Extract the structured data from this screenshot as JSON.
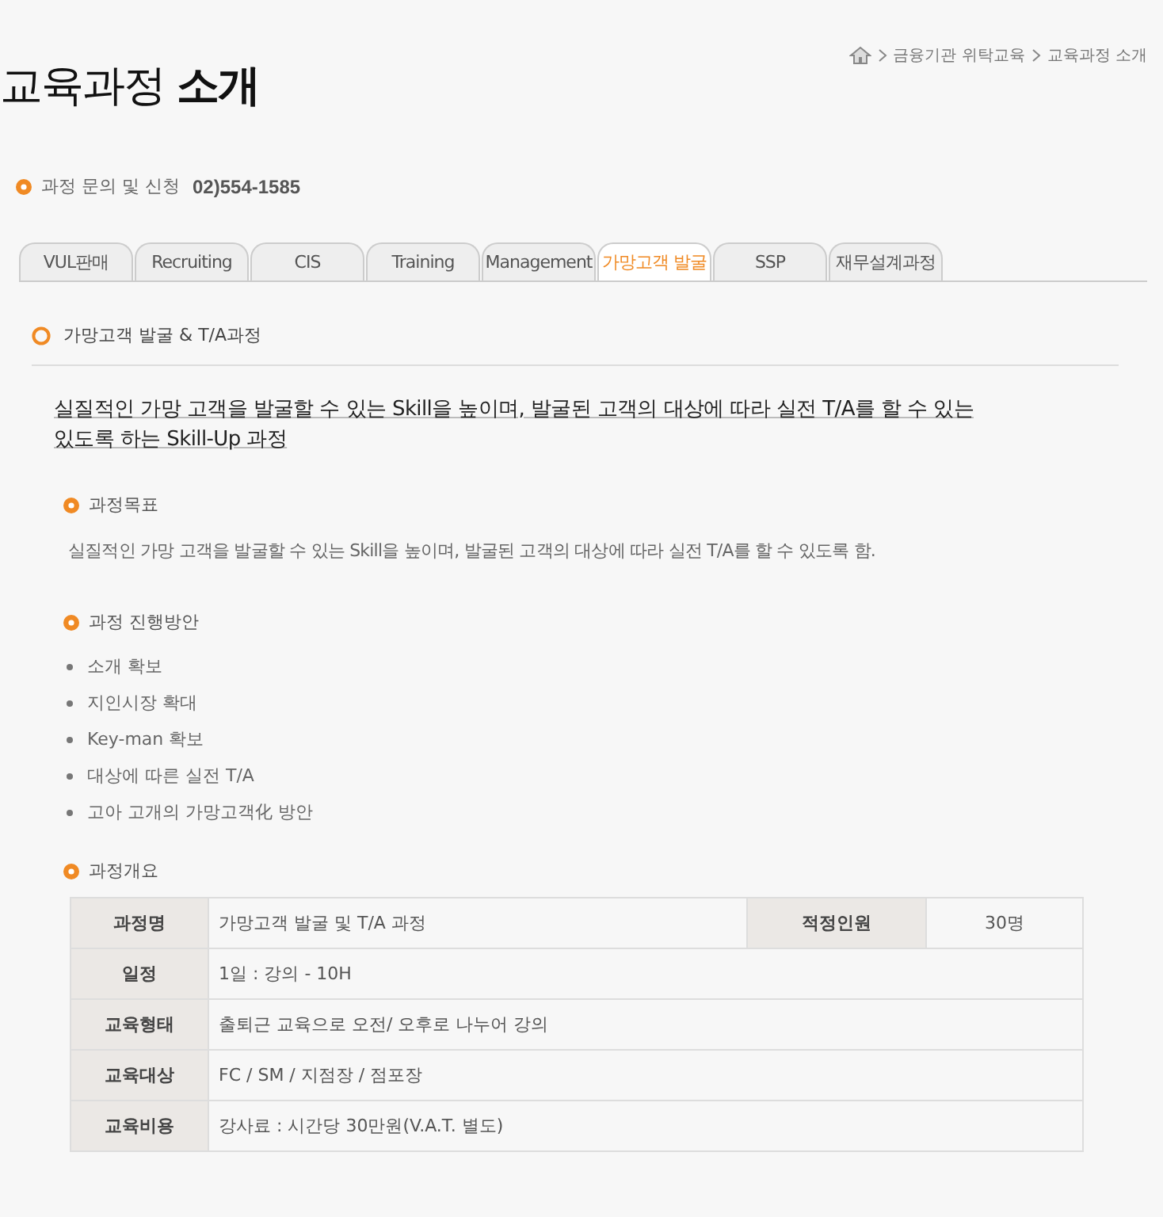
{
  "page_title": "교육과정 **소개**",
  "breadcrumb": [
    "금융기관 위탁교육",
    "교육과정 소개"
  ],
  "contact": {
    "label": "과정 문의 및 신청",
    "phone": "02)554-1585"
  },
  "tabs": [
    {
      "label": "VUL판매",
      "selected": false
    },
    {
      "label": "Recruiting",
      "selected": false
    },
    {
      "label": "CIS",
      "selected": false
    },
    {
      "label": "Training",
      "selected": false
    },
    {
      "label": "Management",
      "selected": false
    },
    {
      "label": "가망고객 발굴",
      "selected": true
    },
    {
      "label": "SSP",
      "selected": false
    },
    {
      "label": "재무설계과정",
      "selected": false
    }
  ],
  "section_title": "가망고객 발굴 & T/A과정",
  "headline": "실질적인 가망 고객을 발굴할 수 있는 Skill을 높이며, 발굴된 고객의 대상에 따라 실전 T/A를 할 수 있는 있도록 하는 Skill-Up 과정",
  "goal": {
    "heading": "과정목표",
    "text": "실질적인 가망 고객을 발굴할 수 있는 Skill을 높이며, 발굴된 고객의 대상에 따라 실전 T/A를 할 수 있도록 함."
  },
  "plan": {
    "heading": "과정 진행방안",
    "items": [
      "소개 확보",
      "지인시장 확대",
      "Key-man 확보",
      "대상에 따른 실전 T/A",
      "고아 고개의 가망고객化 방안"
    ]
  },
  "overview": {
    "heading": "과정개요",
    "rows": [
      [
        {
          "kind": "header",
          "text": "과정명"
        },
        {
          "kind": "value",
          "text": "가망고객 발굴 및 T/A 과정"
        },
        {
          "kind": "header",
          "text": "적정인원"
        },
        {
          "kind": "value",
          "text": "30명"
        }
      ],
      [
        {
          "kind": "header",
          "text": "일정"
        },
        {
          "kind": "value",
          "text": "1일 : 강의 - 10H",
          "colspan": 3
        }
      ],
      [
        {
          "kind": "header",
          "text": "교육형태"
        },
        {
          "kind": "value",
          "text": "출퇴근 교육으로 오전/ 오후로 나누어 강의",
          "colspan": 3
        }
      ],
      [
        {
          "kind": "header",
          "text": "교육대상"
        },
        {
          "kind": "value",
          "text": "FC / SM / 지점장 / 점포장",
          "colspan": 3
        }
      ],
      [
        {
          "kind": "header",
          "text": "교육비용"
        },
        {
          "kind": "value",
          "text": "강사료 : 시간당 30만원(V.A.T. 별도)",
          "colspan": 3
        }
      ]
    ]
  }
}
